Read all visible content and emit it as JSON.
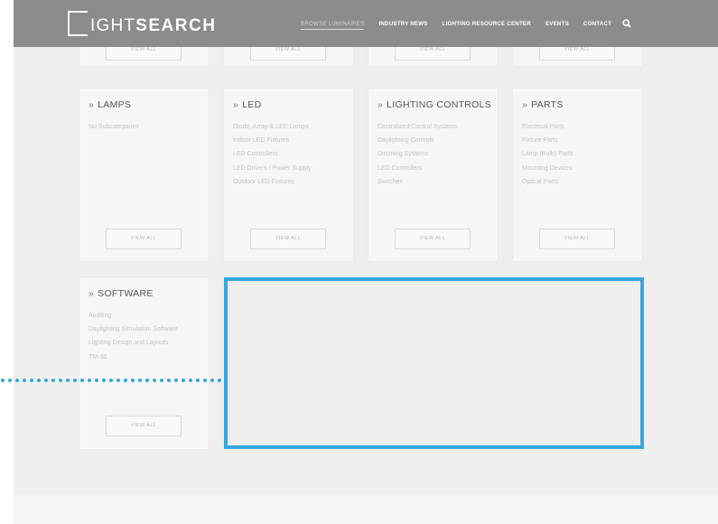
{
  "header": {
    "logo_first_letter": "L",
    "logo_thin": "IGHT",
    "logo_bold": "SEARCH",
    "nav": [
      {
        "label": "BROWSE LUMINAIRES",
        "active": true
      },
      {
        "label": "INDUSTRY NEWS",
        "active": false
      },
      {
        "label": "LIGHTING RESOURCE CENTER",
        "active": false
      },
      {
        "label": "EVENTS",
        "active": false
      },
      {
        "label": "CONTACT",
        "active": false
      }
    ]
  },
  "view_all_label": "VIEW ALL",
  "chevron": "»",
  "categories": [
    {
      "title": "LAMPS",
      "items": [
        "No Subcategories"
      ]
    },
    {
      "title": "LED",
      "items": [
        "Diode, Array & LED Lamps",
        "Indoor LED Fixtures",
        "LED Controllers",
        "LED Drivers / Power Supply",
        "Outdoor LED Fixtures"
      ]
    },
    {
      "title": "LIGHTING CONTROLS",
      "items": [
        "Centralized Control Systems",
        "Daylighting Controls",
        "Dimming Systems",
        "LED Controllers",
        "Switches"
      ]
    },
    {
      "title": "PARTS",
      "items": [
        "Electrical Parts",
        "Fixture Parts",
        "Lamp (Bulb) Parts",
        "Mounting Devices",
        "Optical Parts"
      ]
    },
    {
      "title": "SOFTWARE",
      "items": [
        "Auditing",
        "Daylighting Simulation Software",
        "Lighting Design and Layouts",
        "TM-30"
      ]
    }
  ],
  "colors": {
    "header_bg": "#8c8c8c",
    "page_bg": "#efefef",
    "card_bg": "#f6f6f6",
    "highlight": "#37a6dc"
  }
}
